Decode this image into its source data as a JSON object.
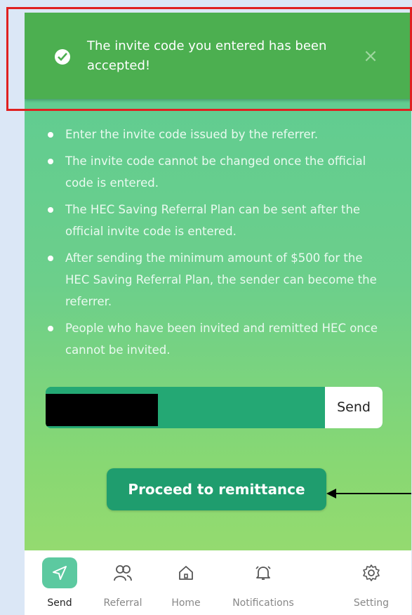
{
  "toast": {
    "message": "The invite code you entered has been accepted!",
    "close_symbol": "×",
    "icon": "check-circle-icon"
  },
  "rules": [
    "Enter the invite code issued by the referrer.",
    "The invite code cannot be changed once the official code is entered.",
    "The HEC Saving Referral Plan can be sent after the official invite code is entered.",
    "After sending the minimum amount of $500 for the HEC Saving Referral Plan, the sender can become the referrer.",
    "People who have been invited and remitted HEC once cannot be invited."
  ],
  "invite": {
    "send_label": "Send"
  },
  "proceed_label": "Proceed to remittance",
  "nav": {
    "items": [
      {
        "label": "Send",
        "icon": "send-icon",
        "active": true
      },
      {
        "label": "Referral",
        "icon": "referral-icon",
        "active": false
      },
      {
        "label": "Home",
        "icon": "home-icon",
        "active": false
      },
      {
        "label": "Notifications",
        "icon": "bell-icon",
        "active": false
      },
      {
        "label": "Setting",
        "icon": "gear-icon",
        "active": false
      }
    ]
  },
  "colors": {
    "toast": "#4caf50",
    "accent": "#1f9d6e",
    "frame": "#e02020"
  }
}
